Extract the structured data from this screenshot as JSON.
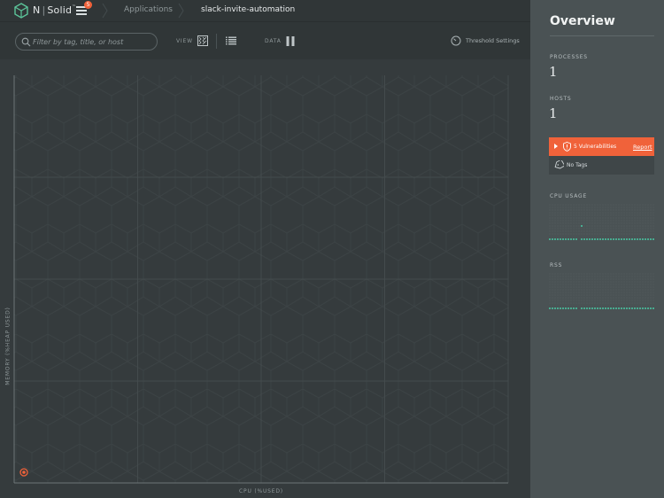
{
  "nav": {
    "brand": "N|Solid",
    "trademark": "™",
    "menu_badge": "5",
    "breadcrumbs": [
      "Applications",
      "slack-invite-automation"
    ]
  },
  "toolbar": {
    "search_placeholder": "Filter by tag, title, or host",
    "search_value": "",
    "view_label": "VIEW",
    "data_label": "DATA",
    "threshold_label": "Threshold Settings"
  },
  "chart_data": {
    "type": "scatter",
    "title": "",
    "xlabel": "CPU (%USED)",
    "ylabel": "MEMORY (%HEAP USED)",
    "grid": true,
    "series": [
      {
        "x": [
          0
        ],
        "y": [
          0
        ],
        "color": "#f0623a"
      }
    ]
  },
  "overview": {
    "title": "Overview",
    "processes_label": "PROCESSES",
    "processes_value": "1",
    "hosts_label": "HOSTS",
    "hosts_value": "1",
    "vulnerabilities_text": "5 Vulnerabilities",
    "report_label": "Report",
    "tags_text": "No Tags",
    "cpu_usage_label": "CPU USAGE",
    "rss_label": "RSS"
  },
  "colors": {
    "accent": "#f0623a",
    "spark": "#49c9a4",
    "panel": "#4a5254",
    "background": "#33393b"
  }
}
